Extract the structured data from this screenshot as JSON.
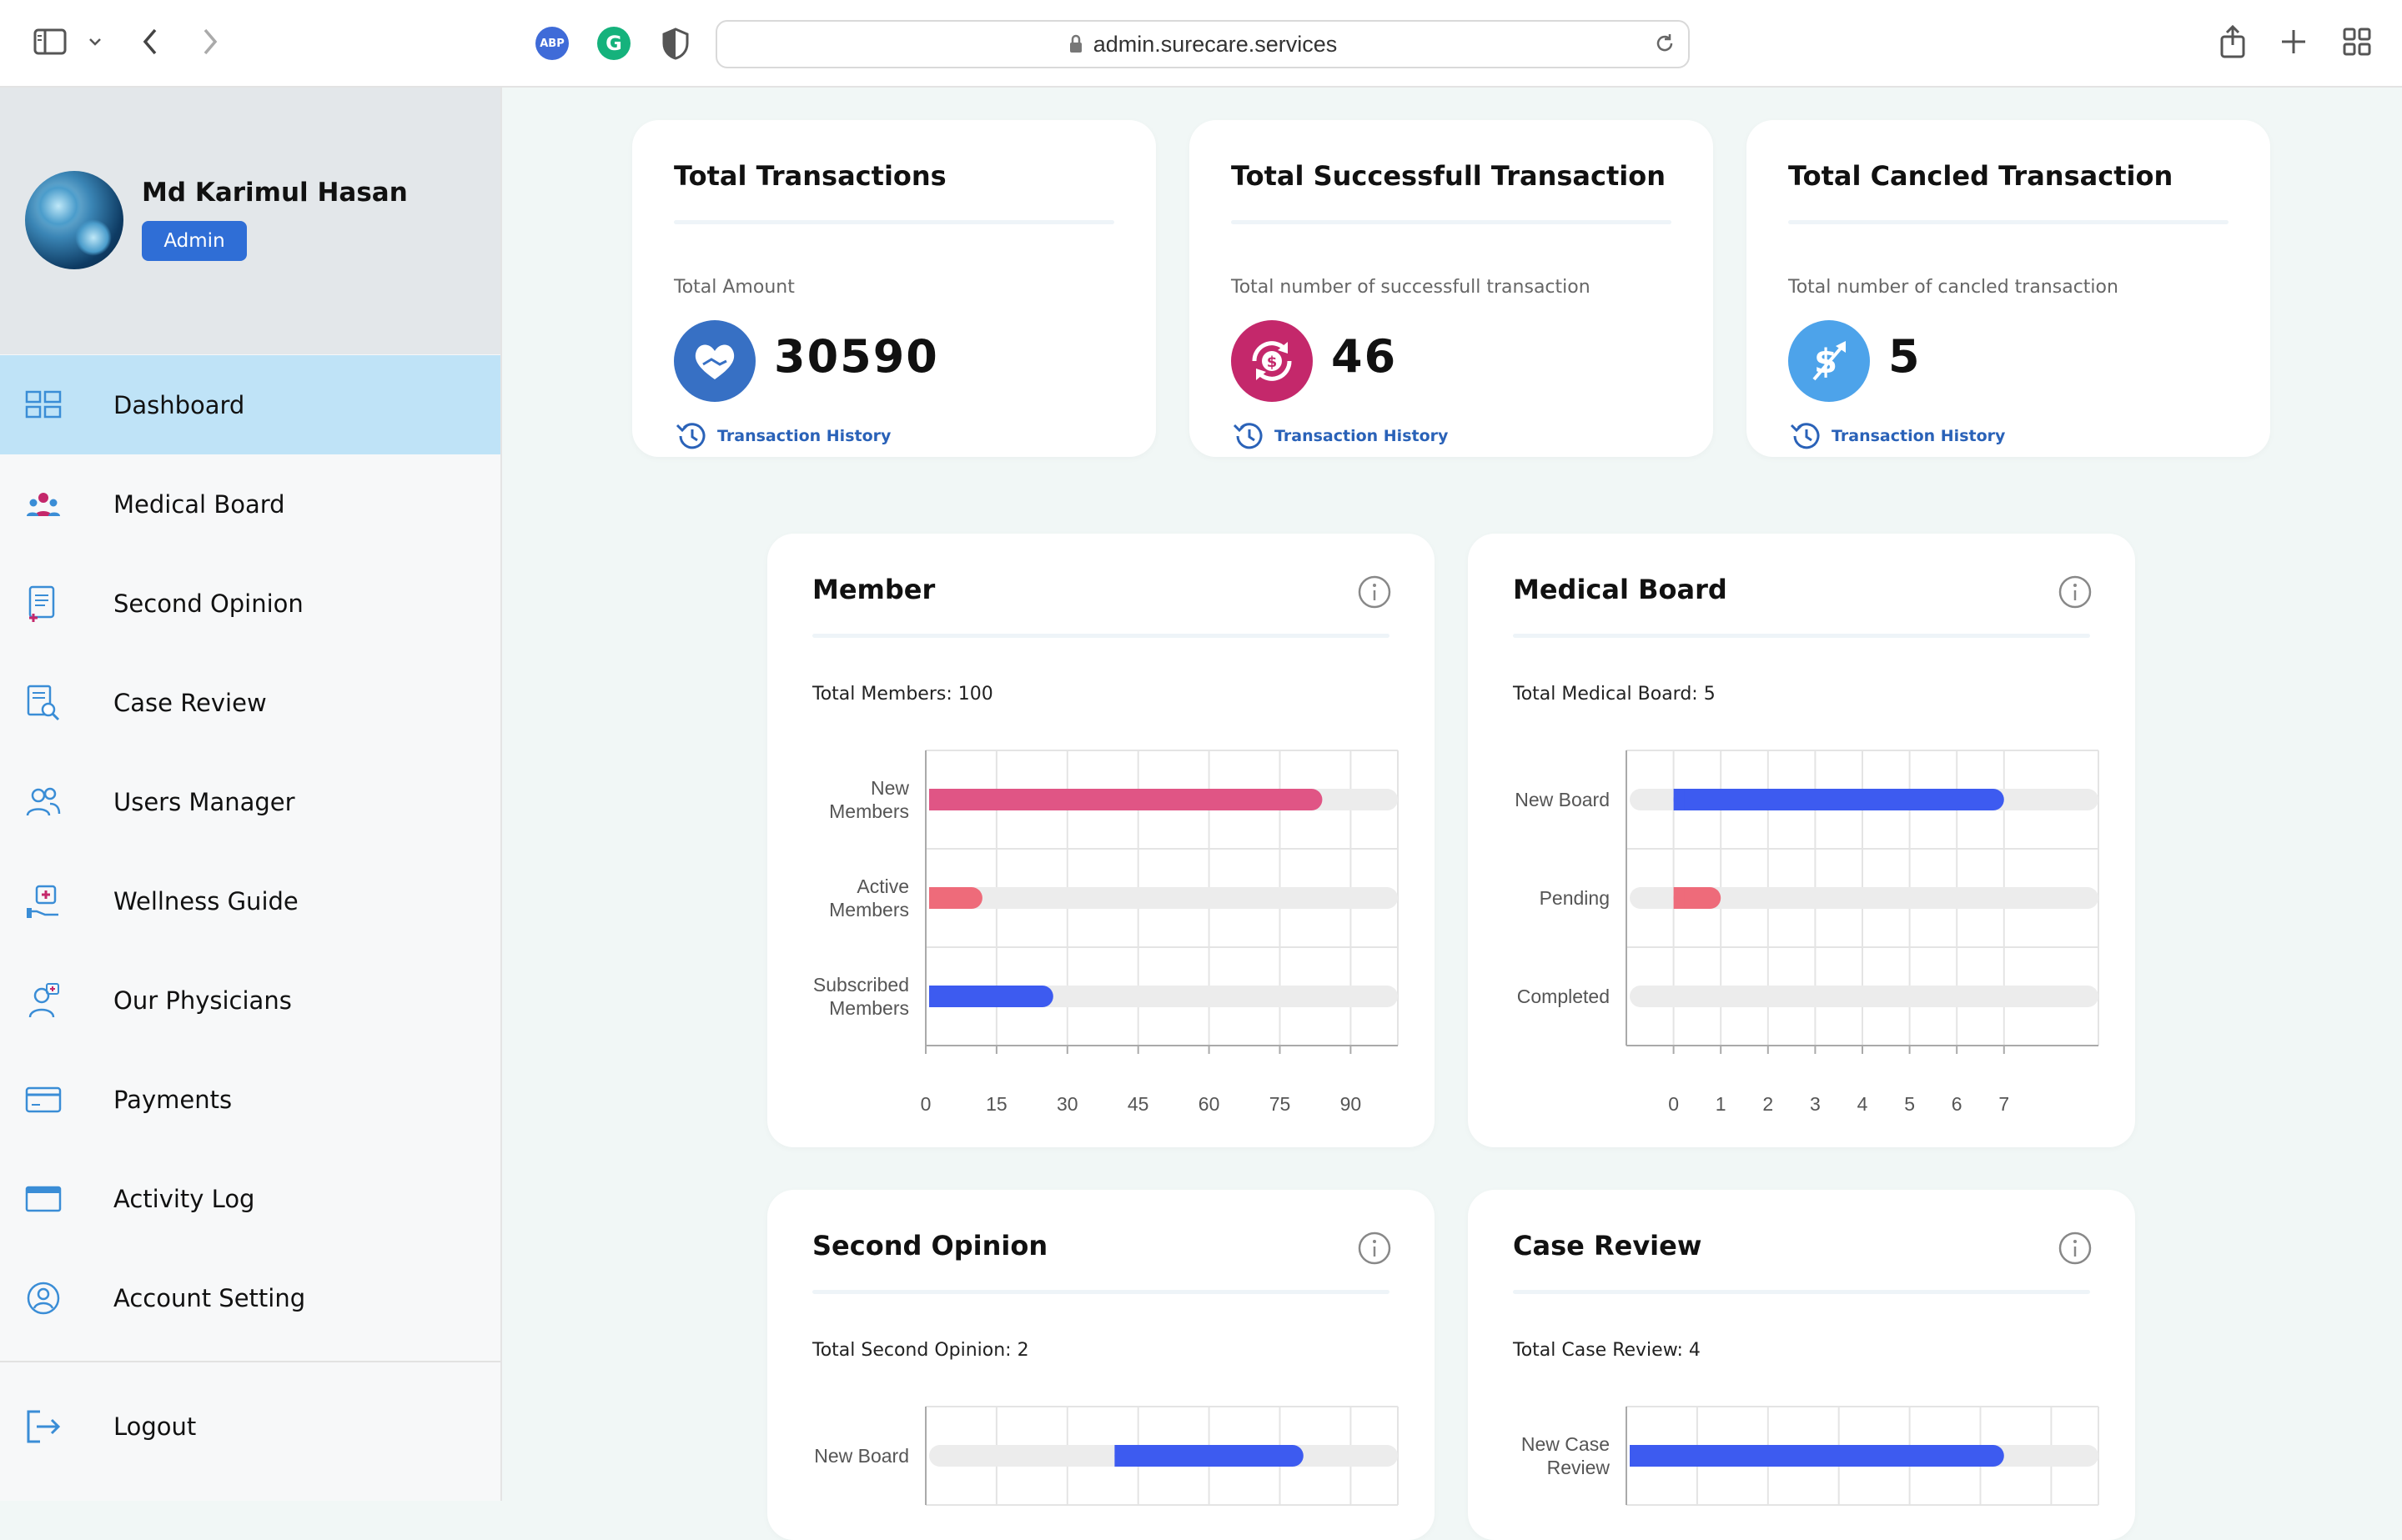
{
  "browser": {
    "url": "admin.surecare.services",
    "ext_abp": "ABP",
    "ext_grammarly": "G"
  },
  "profile": {
    "name": "Md Karimul Hasan",
    "role": "Admin"
  },
  "sidebar": {
    "items": [
      {
        "label": "Dashboard",
        "icon": "grid-icon"
      },
      {
        "label": "Medical Board",
        "icon": "team-icon"
      },
      {
        "label": "Second Opinion",
        "icon": "document-plus-icon"
      },
      {
        "label": "Case Review",
        "icon": "document-search-icon"
      },
      {
        "label": "Users Manager",
        "icon": "users-icon"
      },
      {
        "label": "Wellness Guide",
        "icon": "medkit-hand-icon"
      },
      {
        "label": "Our Physicians",
        "icon": "physician-icon"
      },
      {
        "label": "Payments",
        "icon": "card-icon"
      },
      {
        "label": "Activity Log",
        "icon": "log-icon"
      },
      {
        "label": "Account Setting",
        "icon": "account-icon"
      }
    ],
    "logout": "Logout"
  },
  "stats": [
    {
      "title": "Total Transactions",
      "subtitle": "Total Amount",
      "value": "30590",
      "link": "Transaction History",
      "icon": "handshake-heart-icon",
      "color": "#3770c4"
    },
    {
      "title": "Total Successfull Transaction",
      "subtitle": "Total number of successfull transaction",
      "value": "46",
      "link": "Transaction History",
      "icon": "dollar-cycle-icon",
      "color": "#c4286b"
    },
    {
      "title": "Total Cancled Transaction",
      "subtitle": "Total number of cancled transaction",
      "value": "5",
      "link": "Transaction History",
      "icon": "dollar-arrow-icon",
      "color": "#4da3ea"
    }
  ],
  "charts": {
    "member": {
      "title": "Member",
      "subtitle": "Total Members: 100"
    },
    "board": {
      "title": "Medical Board",
      "subtitle": "Total Medical Board: 5"
    },
    "opinion": {
      "title": "Second Opinion",
      "subtitle": "Total Second Opinion: 2"
    },
    "review": {
      "title": "Case Review",
      "subtitle": "Total Case Review: 4"
    }
  },
  "chart_data": [
    {
      "type": "bar",
      "orientation": "horizontal",
      "title": "Member",
      "categories": [
        "New Members",
        "Active Members",
        "Subscribed Members"
      ],
      "ranges": [
        [
          0,
          84
        ],
        [
          0,
          12
        ],
        [
          0,
          27
        ]
      ],
      "colors": [
        "#e05585",
        "#ee6b7a",
        "#3d5bf0"
      ],
      "xticks": [
        0,
        15,
        30,
        45,
        60,
        75,
        90
      ],
      "xlim": [
        0,
        100
      ]
    },
    {
      "type": "bar",
      "orientation": "horizontal",
      "title": "Medical Board",
      "categories": [
        "New Board",
        "Pending",
        "Completed"
      ],
      "ranges": [
        [
          0,
          7
        ],
        [
          0,
          1
        ],
        [
          0,
          0
        ]
      ],
      "colors": [
        "#3d5bf0",
        "#ee6b7a",
        "#3d5bf0"
      ],
      "xticks": [
        0,
        1,
        2,
        3,
        4,
        5,
        6,
        7
      ],
      "xlim": [
        -1,
        9
      ]
    },
    {
      "type": "bar",
      "orientation": "horizontal",
      "title": "Second Opinion",
      "categories": [
        "New Board"
      ],
      "ranges": [
        [
          1,
          2
        ]
      ],
      "colors": [
        "#3d5bf0"
      ],
      "xticks": [],
      "xlim": [
        0,
        2.5
      ]
    },
    {
      "type": "bar",
      "orientation": "horizontal",
      "title": "Case Review",
      "categories": [
        "New Case Review"
      ],
      "ranges": [
        [
          0,
          3.2
        ]
      ],
      "colors": [
        "#3d5bf0"
      ],
      "xticks": [],
      "xlim": [
        0,
        4
      ]
    }
  ]
}
